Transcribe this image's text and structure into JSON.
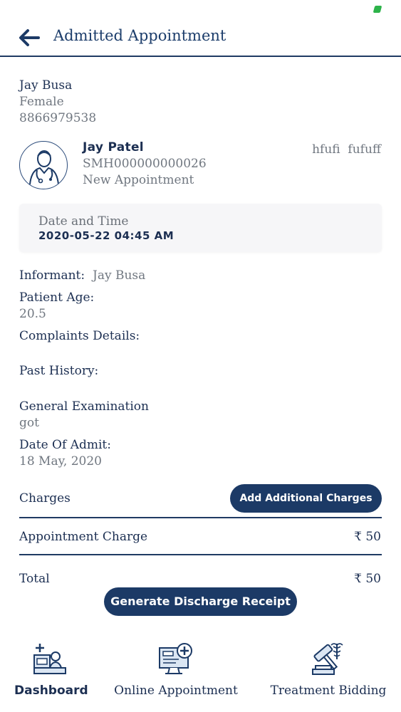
{
  "header": {
    "title": "Admitted Appointment"
  },
  "patient": {
    "name": "Jay Busa",
    "gender": "Female",
    "phone": "8866979538"
  },
  "doctor": {
    "name": "Jay Patel",
    "id": "SMH000000000026",
    "status": "New Appointment",
    "right_text": "hfufi  fufuff"
  },
  "datetime": {
    "label": "Date and Time",
    "value": "2020-05-22 04:45 AM"
  },
  "details": {
    "informant_label": "Informant:",
    "informant_value": "Jay Busa",
    "age_label": "Patient Age:",
    "age_value": "20.5",
    "complaints_label": "Complaints Details:",
    "past_history_label": "Past History:",
    "general_exam_label": "General Examination",
    "general_exam_value": "got",
    "admit_label": "Date Of Admit:",
    "admit_value": "18 May, 2020"
  },
  "charges": {
    "label": "Charges",
    "add_button": "Add Additional Charges",
    "appointment_label": "Appointment Charge",
    "appointment_value": "₹ 50",
    "total_label": "Total",
    "total_value": "₹ 50"
  },
  "discharge_button": "Generate Discharge Receipt",
  "bottom_nav": [
    {
      "label": "Dashboard",
      "icon": "dashboard-icon"
    },
    {
      "label": "Online Appointment",
      "icon": "online-appointment-icon"
    },
    {
      "label": "Treatment Bidding",
      "icon": "treatment-bidding-icon"
    }
  ],
  "colors": {
    "primary": "#1c3a66",
    "text_dark": "#1c2f52",
    "text_grey": "#707780",
    "card_bg": "#f6f6f8"
  }
}
